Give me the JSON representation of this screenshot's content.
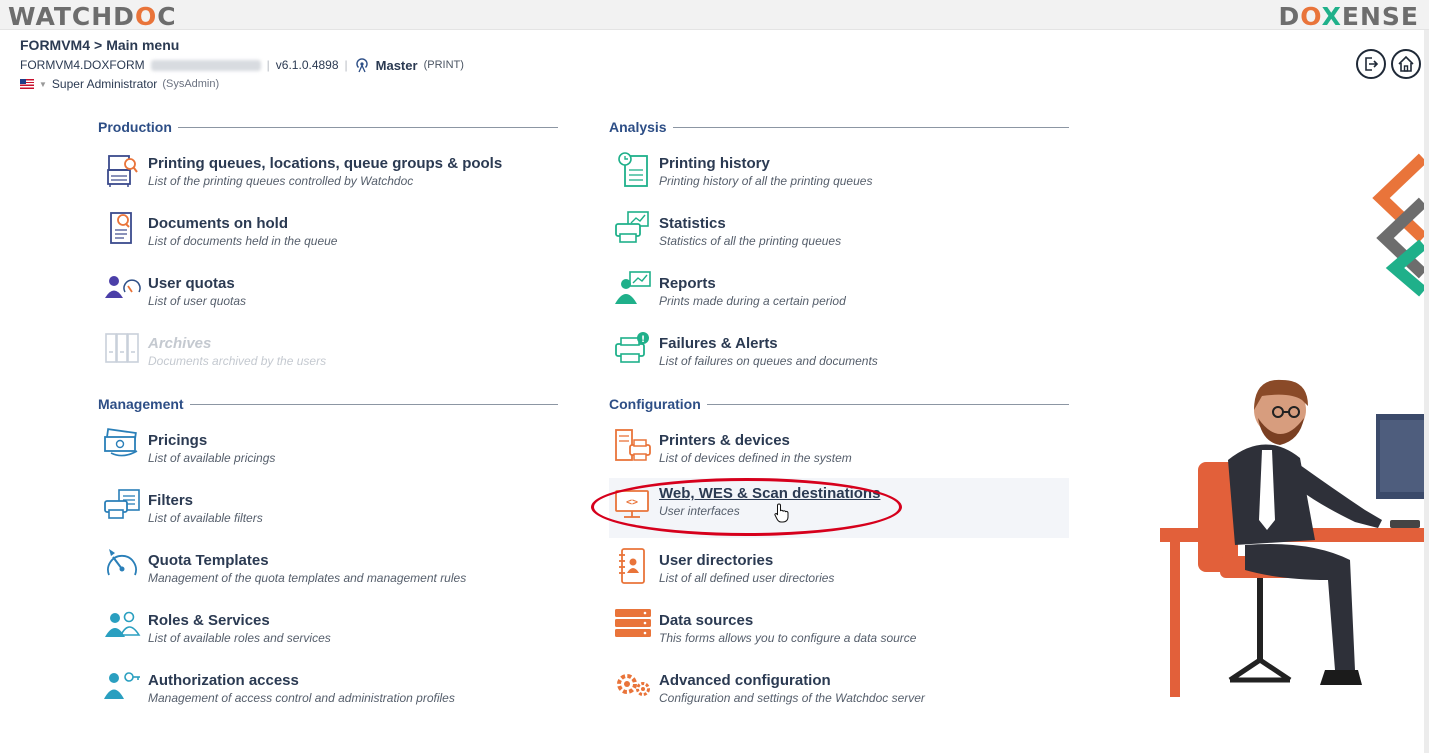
{
  "brand": {
    "left_pre": "WATCHD",
    "left_accent": "O",
    "left_post": "C",
    "right_pre": "D",
    "right_accent": "O",
    "right_accent2": "X",
    "right_post": "ENSE"
  },
  "header": {
    "breadcrumb_server": "FORMVM4",
    "breadcrumb_sep": ">",
    "breadcrumb_page": "Main menu",
    "server_name": "FORMVM4.DOXFORM",
    "separator": "|",
    "version": "v6.1.0.4898",
    "role": "Master",
    "role_tag": "(PRINT)",
    "user": "Super Administrator",
    "user_tag": "(SysAdmin)"
  },
  "sections": {
    "production": {
      "title": "Production",
      "items": [
        {
          "title": "Printing queues, locations, queue groups & pools",
          "desc": "List of the printing queues controlled by Watchdoc",
          "icon": "printer-search-icon"
        },
        {
          "title": "Documents on hold",
          "desc": "List of documents held in the queue",
          "icon": "document-search-icon"
        },
        {
          "title": "User quotas",
          "desc": "List of user quotas",
          "icon": "user-gauge-icon"
        },
        {
          "title": "Archives",
          "desc": "Documents archived by the users",
          "icon": "archive-icon"
        }
      ]
    },
    "analysis": {
      "title": "Analysis",
      "items": [
        {
          "title": "Printing history",
          "desc": "Printing history of all the printing queues",
          "icon": "history-icon"
        },
        {
          "title": "Statistics",
          "desc": "Statistics of all the printing queues",
          "icon": "printer-chart-icon"
        },
        {
          "title": "Reports",
          "desc": "Prints made during a certain period",
          "icon": "user-chart-icon"
        },
        {
          "title": "Failures & Alerts",
          "desc": "List of failures on queues and documents",
          "icon": "printer-alert-icon"
        }
      ]
    },
    "management": {
      "title": "Management",
      "items": [
        {
          "title": "Pricings",
          "desc": "List of available pricings",
          "icon": "money-icon"
        },
        {
          "title": "Filters",
          "desc": "List of available filters",
          "icon": "filter-icon"
        },
        {
          "title": "Quota Templates",
          "desc": "Management of the quota templates and management rules",
          "icon": "gauge-icon"
        },
        {
          "title": "Roles & Services",
          "desc": "List of available roles and services",
          "icon": "users-icon"
        },
        {
          "title": "Authorization access",
          "desc": "Management of access control and administration profiles",
          "icon": "user-key-icon"
        }
      ]
    },
    "configuration": {
      "title": "Configuration",
      "items": [
        {
          "title": "Printers & devices",
          "desc": "List of devices defined in the system",
          "icon": "devices-icon"
        },
        {
          "title": "Web, WES & Scan destinations",
          "desc": "User interfaces",
          "icon": "monitor-code-icon"
        },
        {
          "title": "User directories",
          "desc": "List of all defined user directories",
          "icon": "address-book-icon"
        },
        {
          "title": "Data sources",
          "desc": "This forms allows you to configure a data source",
          "icon": "server-icon"
        },
        {
          "title": "Advanced configuration",
          "desc": "Configuration and settings of the Watchdoc server",
          "icon": "gears-icon"
        }
      ]
    }
  },
  "colors": {
    "accent": "#e9743a",
    "teal": "#1fb08a",
    "heading": "#2d4e86",
    "text": "#2b3a52",
    "highlight": "#d6001c"
  }
}
